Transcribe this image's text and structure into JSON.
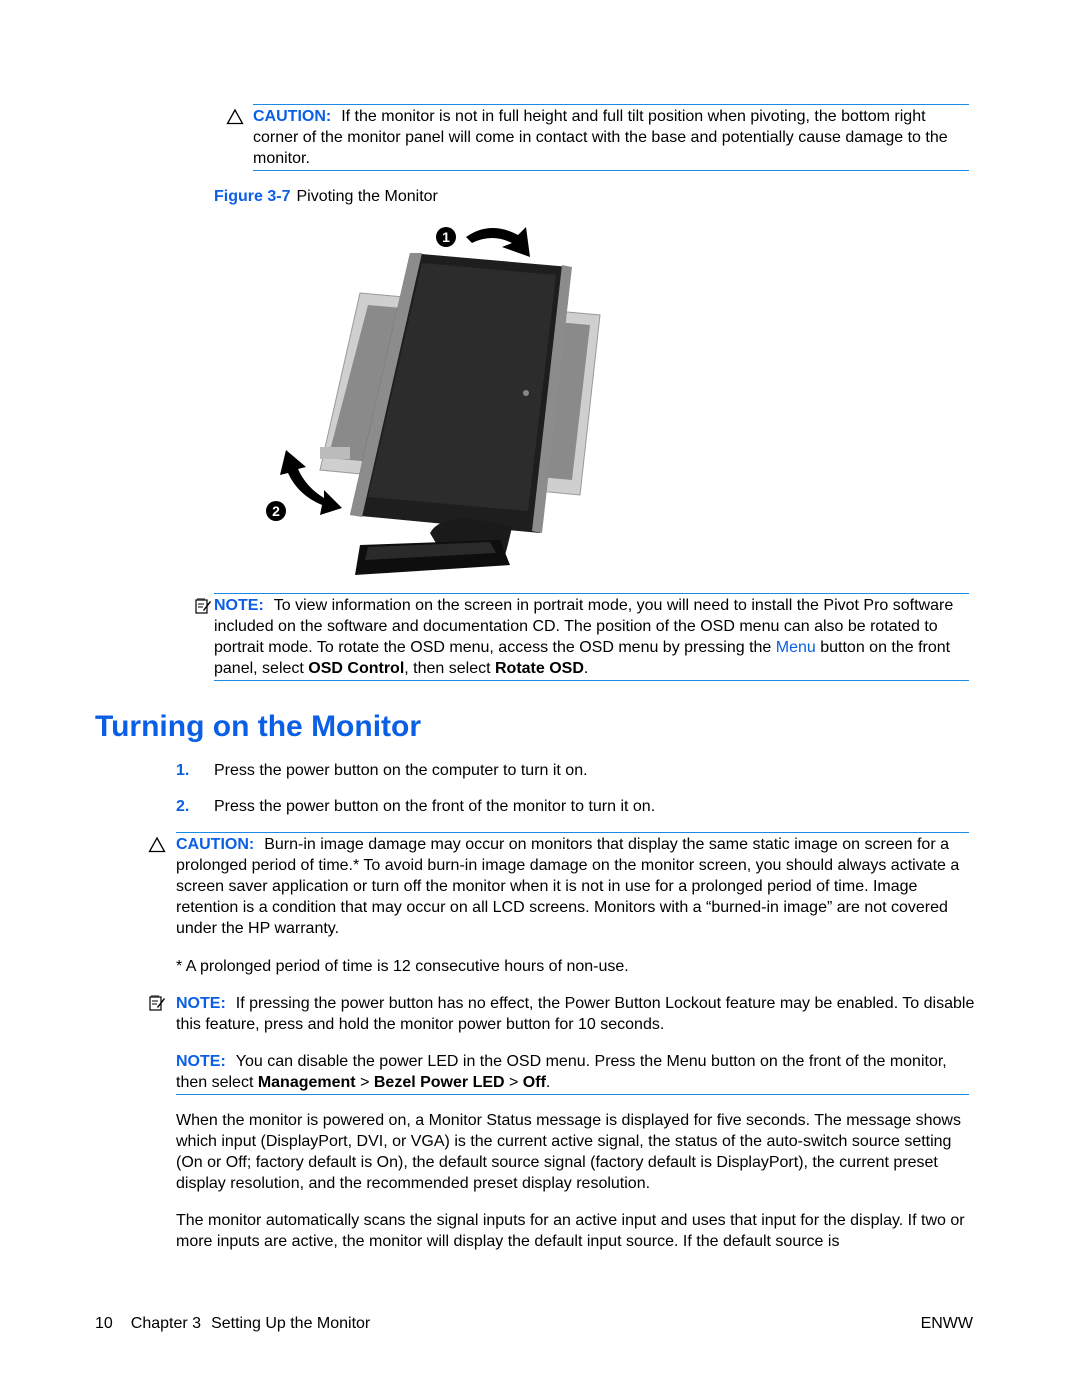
{
  "caution1": {
    "label": "CAUTION:",
    "text": "If the monitor is not in full height and full tilt position when pivoting, the bottom right corner of the monitor panel will come in contact with the base and potentially cause damage to the monitor."
  },
  "figure": {
    "label": "Figure 3-7",
    "caption": "Pivoting the Monitor",
    "callout1": "1",
    "callout2": "2"
  },
  "note1": {
    "label": "NOTE:",
    "text_a": "To view information on the screen in portrait mode, you will need to install the Pivot Pro software included on the software and documentation CD. The position of the OSD menu can also be rotated to portrait mode. To rotate the OSD menu, access the OSD menu by pressing the ",
    "link": "Menu",
    "text_b": " button on the front panel, select ",
    "bold1": "OSD Control",
    "text_c": ", then select ",
    "bold2": "Rotate OSD",
    "text_d": "."
  },
  "section": {
    "title": "Turning on the Monitor",
    "steps": [
      {
        "num": "1.",
        "text": "Press the power button on the computer to turn it on."
      },
      {
        "num": "2.",
        "text": "Press the power button on the front of the monitor to turn it on."
      }
    ]
  },
  "caution2": {
    "label": "CAUTION:",
    "text": "Burn-in image damage may occur on monitors that display the same static image on screen for a prolonged period of time.* To avoid burn-in image damage on the monitor screen, you should always activate a screen saver application or turn off the monitor when it is not in use for a prolonged period of time. Image retention is a condition that may occur on all LCD screens. Monitors with a “burned-in image” are not covered under the HP warranty.",
    "footnote": "* A prolonged period of time is 12 consecutive hours of non-use."
  },
  "note2": {
    "label": "NOTE:",
    "text": "If pressing the power button has no effect, the Power Button Lockout feature may be enabled. To disable this feature, press and hold the monitor power button for 10 seconds."
  },
  "note3": {
    "label": "NOTE:",
    "text_a": "You can disable the power LED in the OSD menu. Press the Menu button on the front of the monitor, then select ",
    "bold1": "Management",
    "sep1": " > ",
    "bold2": "Bezel Power LED",
    "sep2": " > ",
    "bold3": "Off",
    "text_b": "."
  },
  "body": {
    "para1": "When the monitor is powered on, a Monitor Status message is displayed for five seconds. The message shows which input (DisplayPort, DVI, or VGA) is the current active signal, the status of the auto-switch source setting (On or Off; factory default is On), the default source signal (factory default is DisplayPort), the current preset display resolution, and the recommended preset display resolution.",
    "para2": "The monitor automatically scans the signal inputs for an active input and uses that input for the display. If two or more inputs are active, the monitor will display the default input source. If the default source is"
  },
  "footer": {
    "page_number": "10",
    "chapter": "Chapter 3",
    "chapter_title": "Setting Up the Monitor",
    "locale": "ENWW"
  }
}
